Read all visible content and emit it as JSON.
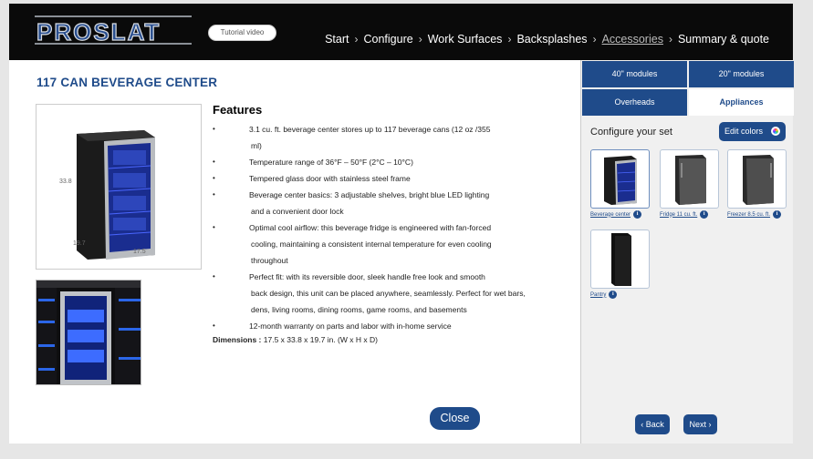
{
  "header": {
    "logo_text": "PROSLAT",
    "tutorial_label": "Tutorial video",
    "nav": [
      {
        "label": "Start",
        "active": false
      },
      {
        "label": "Configure",
        "active": false
      },
      {
        "label": "Work Surfaces",
        "active": false
      },
      {
        "label": "Backsplashes",
        "active": false
      },
      {
        "label": "Accessories",
        "active": true
      },
      {
        "label": "Summary & quote",
        "active": false
      }
    ],
    "nav_separator": "›"
  },
  "product": {
    "title": "117 CAN BEVERAGE CENTER",
    "dimensions_labels": {
      "height": "33.8",
      "depth": "19.7",
      "width": "17.5"
    },
    "features_title": "Features",
    "features": [
      [
        "3.1 cu. ft. beverage center stores up to 117 beverage cans (12 oz /355",
        "ml)"
      ],
      [
        "Temperature range of 36°F – 50°F (2°C – 10°C)"
      ],
      [
        "Tempered glass door with stainless steel frame"
      ],
      [
        "Beverage center basics: 3 adjustable shelves, bright blue LED lighting",
        "and a convenient door lock"
      ],
      [
        "Optimal cool airflow: this beverage fridge is engineered with fan-forced",
        "cooling, maintaining a consistent internal temperature for even cooling",
        "throughout"
      ],
      [
        "Perfect fit: with its reversible door, sleek handle free look and smooth",
        "back design, this unit can be placed anywhere, seamlessly. Perfect for wet bars,",
        "dens, living rooms, dining rooms, game rooms, and basements"
      ],
      [
        "12-month warranty on parts and labor with in-home service"
      ]
    ],
    "bullet": "•",
    "dimensions_label": "Dimensions :",
    "dimensions_value": "17.5 x 33.8 x 19.7 in. (W x H x D)",
    "close_label": "Close"
  },
  "sidebar": {
    "tabs": [
      {
        "label": "40\" modules"
      },
      {
        "label": "20\" modules"
      },
      {
        "label": "Overheads"
      },
      {
        "label": "Appliances"
      }
    ],
    "configure_label": "Configure your set",
    "edit_colors_label": "Edit colors",
    "appliances": [
      {
        "label": "Beverage center"
      },
      {
        "label": "Fridge 11 cu. ft."
      },
      {
        "label": "Freezer 8.5 cu. ft."
      },
      {
        "label": "Pantry"
      }
    ],
    "info_glyph": "i",
    "back_label": "‹ Back",
    "next_label": "Next ›"
  },
  "colors": {
    "primary": "#1f4b8a",
    "header_bg": "#0a0a0a"
  }
}
